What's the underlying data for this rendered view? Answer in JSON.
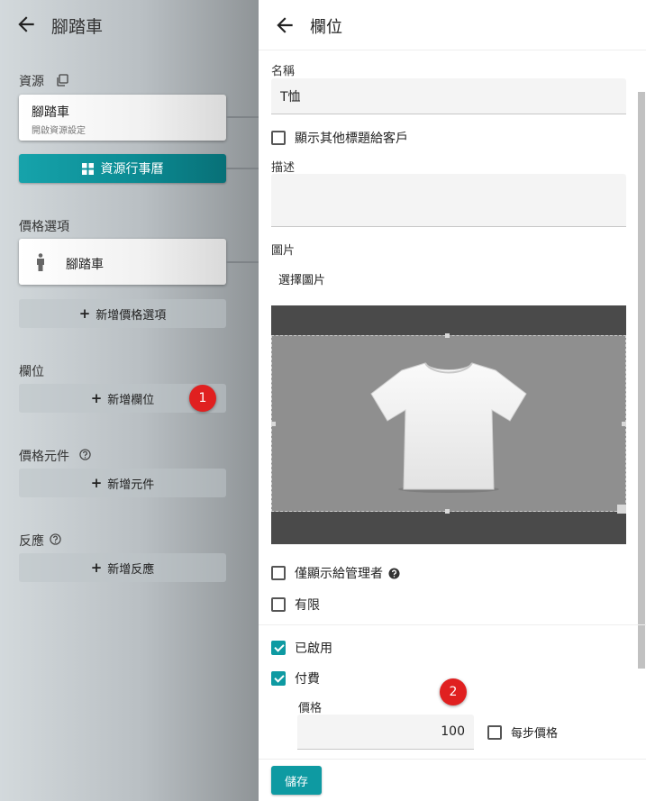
{
  "left_panel": {
    "title": "腳踏車",
    "resources_section": {
      "label": "資源",
      "card_name": "腳踏車",
      "card_sub": "開啟資源設定",
      "calendar_button": "資源行事曆"
    },
    "price_options_section": {
      "label": "價格選項",
      "card_name": "腳踏車",
      "add_button": "新增價格選項"
    },
    "fields_section": {
      "label": "欄位",
      "add_button": "新增欄位",
      "badge": "1"
    },
    "price_components_section": {
      "label": "價格元件",
      "add_button": "新增元件"
    },
    "reactions_section": {
      "label": "反應",
      "add_button": "新增反應"
    }
  },
  "right_panel": {
    "title": "欄位",
    "name_label": "名稱",
    "name_value": "T恤",
    "show_other_title_label": "顯示其他標題給客戶",
    "description_label": "描述",
    "description_value": "",
    "image_label": "圖片",
    "choose_image_label": "選擇圖片",
    "admin_only_label": "僅顯示給管理者",
    "limited_label": "有限",
    "enabled_label": "已啟用",
    "paid_label": "付費",
    "price_label": "價格",
    "price_value": "100",
    "per_step_price_label": "每步價格",
    "save_button": "儲存",
    "badge": "2"
  },
  "colors": {
    "accent": "#0e9aa2",
    "badge": "#e02020"
  }
}
